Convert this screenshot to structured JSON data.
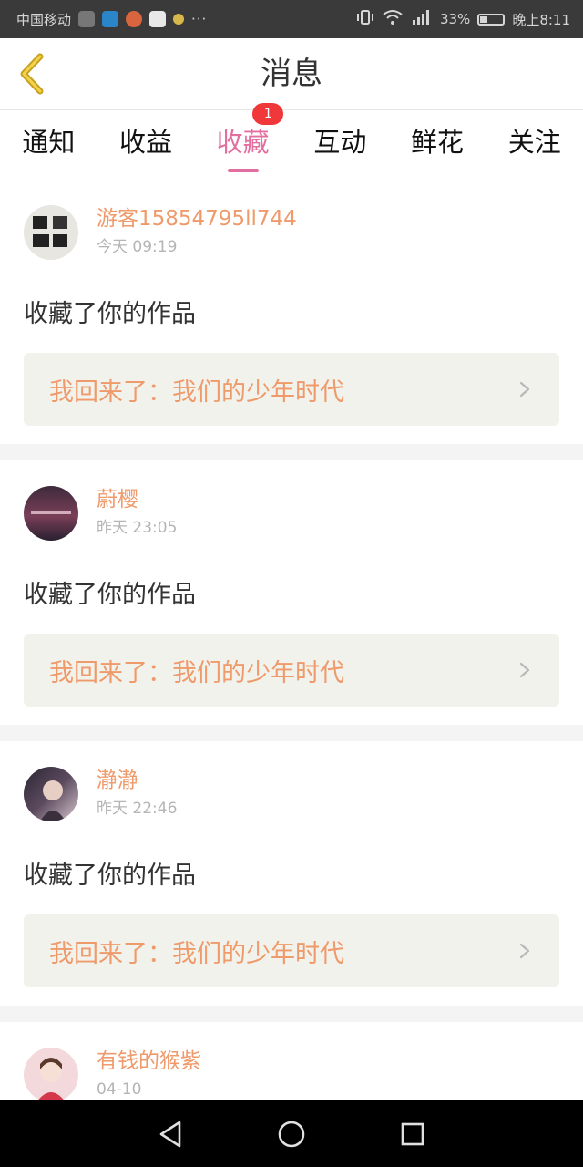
{
  "status_bar": {
    "carrier": "中国移动",
    "battery": "33%",
    "time": "晚上8:11"
  },
  "header": {
    "title": "消息",
    "back_icon": "back-chevron-icon"
  },
  "tabs": [
    {
      "label": "通知",
      "active": false
    },
    {
      "label": "收益",
      "active": false
    },
    {
      "label": "收藏",
      "active": true,
      "badge": "1"
    },
    {
      "label": "互动",
      "active": false
    },
    {
      "label": "鲜花",
      "active": false
    },
    {
      "label": "关注",
      "active": false
    }
  ],
  "messages": [
    {
      "user": "游客15854795ll744",
      "time": "今天 09:19",
      "action": "收藏了你的作品",
      "work": "我回来了：我们的少年时代"
    },
    {
      "user": "蔚樱",
      "time": "昨天 23:05",
      "action": "收藏了你的作品",
      "work": "我回来了：我们的少年时代"
    },
    {
      "user": "瀞瀞",
      "time": "昨天 22:46",
      "action": "收藏了你的作品",
      "work": "我回来了：我们的少年时代"
    },
    {
      "user": "有钱的猴紫",
      "time": "04-10"
    }
  ],
  "colors": {
    "accent_pink": "#e36fa0",
    "username_orange": "#ef9a6b",
    "badge_red": "#f0383a"
  }
}
